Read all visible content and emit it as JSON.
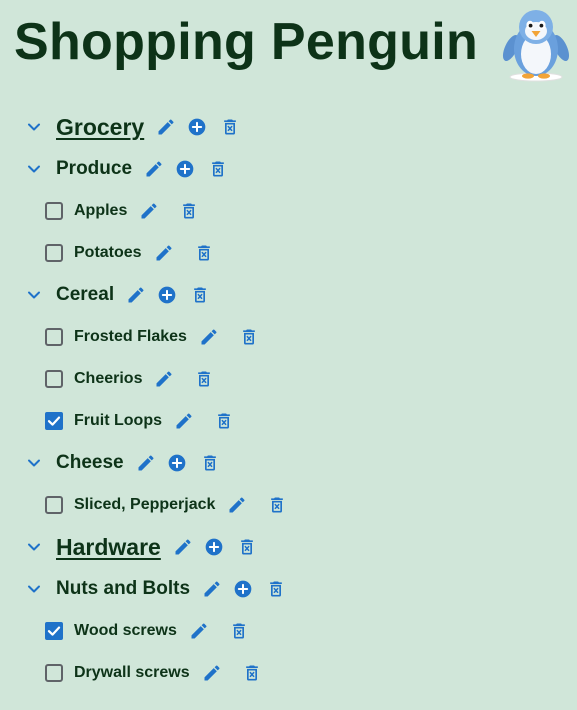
{
  "app": {
    "title": "Shopping Penguin",
    "mascot_icon": "penguin-icon"
  },
  "colors": {
    "background": "#d0e6d9",
    "text": "#0d3318",
    "accent": "#1f72c9",
    "checkbox_border": "#5f6368"
  },
  "tree": {
    "grocery": {
      "label": "Grocery",
      "expanded": true,
      "produce": {
        "label": "Produce",
        "expanded": true,
        "apples": {
          "label": "Apples",
          "checked": false
        },
        "potatoes": {
          "label": "Potatoes",
          "checked": false
        }
      },
      "cereal": {
        "label": "Cereal",
        "expanded": true,
        "frosted_flakes": {
          "label": "Frosted Flakes",
          "checked": false
        },
        "cheerios": {
          "label": "Cheerios",
          "checked": false
        },
        "fruit_loops": {
          "label": "Fruit Loops",
          "checked": true
        }
      },
      "cheese": {
        "label": "Cheese",
        "expanded": true,
        "sliced_pepperjack": {
          "label": "Sliced, Pepperjack",
          "checked": false
        }
      }
    },
    "hardware": {
      "label": "Hardware",
      "expanded": true,
      "nuts_and_bolts": {
        "label": "Nuts and Bolts",
        "expanded": true,
        "wood_screws": {
          "label": "Wood screws",
          "checked": true
        },
        "drywall_screws": {
          "label": "Drywall screws",
          "checked": false
        }
      }
    }
  },
  "icons": {
    "expand": "chevron-down-icon",
    "edit": "pencil-icon",
    "add": "plus-circle-icon",
    "delete": "trash-icon",
    "checkbox_checked": "checkbox-checked-icon",
    "checkbox_unchecked": "checkbox-unchecked-icon"
  }
}
